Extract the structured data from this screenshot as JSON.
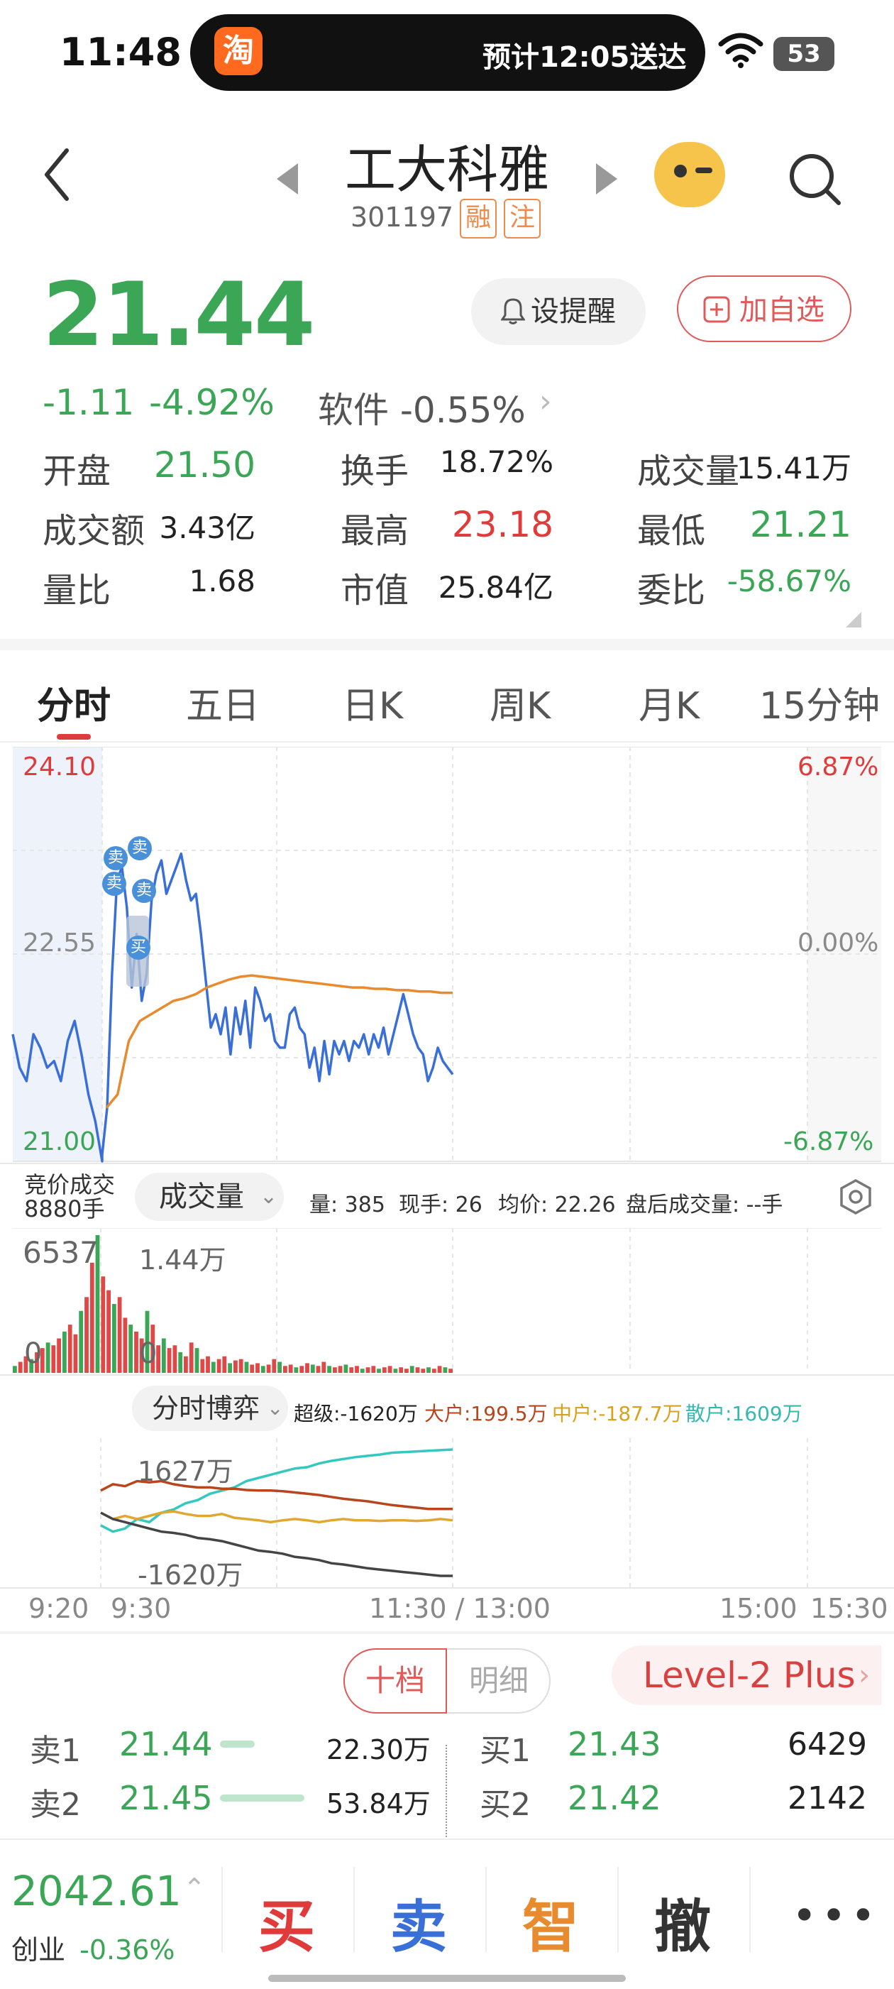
{
  "status": {
    "time": "11:48",
    "island_app_icon": "淘",
    "island_text": "预计12:05送达",
    "battery": "53"
  },
  "header": {
    "title": "工大科雅",
    "code": "301197",
    "tags": [
      "融",
      "注"
    ]
  },
  "quote": {
    "price": "21.44",
    "change": "-1.11",
    "change_pct": "-4.92%",
    "sector": "软件 -0.55%",
    "remind_label": "设提醒",
    "add_fav_label": "加自选",
    "stats": [
      {
        "label": "开盘",
        "value": "21.50",
        "color": "green"
      },
      {
        "label": "换手",
        "value": "18.72%",
        "color": "black"
      },
      {
        "label": "成交量",
        "value": "15.41万",
        "color": "black"
      },
      {
        "label": "成交额",
        "value": "3.43亿",
        "color": "black"
      },
      {
        "label": "最高",
        "value": "23.18",
        "color": "red"
      },
      {
        "label": "最低",
        "value": "21.21",
        "color": "green"
      },
      {
        "label": "量比",
        "value": "1.68",
        "color": "black"
      },
      {
        "label": "市值",
        "value": "25.84亿",
        "color": "black"
      },
      {
        "label": "委比",
        "value": "-58.67%",
        "color": "green"
      }
    ]
  },
  "tabs": [
    "分时",
    "五日",
    "日K",
    "周K",
    "月K",
    "15分钟"
  ],
  "intraday": {
    "y_top": "24.10",
    "y_mid": "22.55",
    "y_bot": "21.00",
    "pct_top": "6.87%",
    "pct_mid": "0.00%",
    "pct_bot": "-6.87%",
    "sell_marker": "卖",
    "buy_marker": "买",
    "price_line": [
      21.95,
      21.7,
      21.6,
      21.95,
      21.85,
      21.7,
      21.75,
      21.6,
      21.9,
      22.05,
      21.8,
      21.5,
      21.3,
      21.0,
      21.05,
      21.4,
      22.4,
      23.1,
      23.2,
      22.9,
      22.3,
      22.7,
      22.2,
      22.4,
      22.95,
      23.15,
      23.25,
      23.0,
      23.1,
      23.2,
      23.3,
      23.1,
      22.95,
      23.0,
      22.7,
      22.35,
      22.0,
      22.1,
      21.95,
      22.15,
      21.8,
      22.15,
      21.95,
      22.2,
      21.85,
      22.3,
      22.2,
      22.05,
      22.1,
      21.9,
      21.85,
      21.85,
      22.1,
      22.15,
      22.0,
      21.95,
      21.7,
      21.85,
      21.6,
      21.9,
      21.65,
      21.9,
      21.8,
      21.9,
      21.75,
      21.9,
      21.85,
      21.95,
      21.8,
      21.95,
      21.85,
      22.0,
      21.8,
      21.95,
      22.1,
      22.25,
      22.1,
      21.95,
      21.85,
      21.8,
      21.6,
      21.7,
      21.85,
      21.75,
      21.7,
      21.65
    ],
    "avg_line": [
      21.4,
      21.5,
      21.9,
      22.05,
      22.1,
      22.15,
      22.2,
      22.22,
      22.25,
      22.3,
      22.33,
      22.36,
      22.38,
      22.39,
      22.38,
      22.37,
      22.36,
      22.35,
      22.34,
      22.33,
      22.32,
      22.31,
      22.3,
      22.3,
      22.29,
      22.29,
      22.28,
      22.28,
      22.27,
      22.27,
      22.26,
      22.26
    ]
  },
  "volume": {
    "auction_label": "竞价成交",
    "auction_value": "8880手",
    "selector": "成交量",
    "vol": "量: 385",
    "cur": "现手: 26",
    "avg": "均价: 22.26",
    "after": "盘后成交量: --手",
    "y_left_top": "6537",
    "y_left_bot": "0",
    "y_right_top": "1.44万",
    "y_right_bot": "0",
    "bars": [
      0.05,
      0.08,
      0.12,
      0.1,
      0.15,
      0.18,
      0.22,
      0.2,
      0.25,
      0.3,
      0.35,
      0.28,
      0.45,
      0.55,
      0.8,
      1.0,
      0.7,
      0.6,
      0.5,
      0.55,
      0.4,
      0.35,
      0.3,
      0.25,
      0.45,
      0.35,
      0.2,
      0.25,
      0.18,
      0.2,
      0.15,
      0.12,
      0.22,
      0.18,
      0.1,
      0.12,
      0.08,
      0.1,
      0.12,
      0.07,
      0.09,
      0.1,
      0.08,
      0.06,
      0.07,
      0.05,
      0.06,
      0.1,
      0.08,
      0.05,
      0.06,
      0.04,
      0.05,
      0.07,
      0.06,
      0.05,
      0.08,
      0.05,
      0.04,
      0.05,
      0.06,
      0.04,
      0.05,
      0.03,
      0.04,
      0.05,
      0.03,
      0.04,
      0.05,
      0.03,
      0.04,
      0.03,
      0.05,
      0.04,
      0.03,
      0.04,
      0.03,
      0.05,
      0.04,
      0.03
    ]
  },
  "flow": {
    "selector": "分时博弈",
    "super": "超级:-1620万",
    "big": "大户:199.5万",
    "mid": "中户:-187.7万",
    "retail": "散户:1609万",
    "y_top": "1627万",
    "y_bot": "-1620万",
    "series": {
      "retail": [
        -0.2,
        -0.3,
        -0.25,
        -0.1,
        -0.15,
        0.0,
        0.05,
        0.15,
        0.2,
        0.3,
        0.35,
        0.4,
        0.5,
        0.55,
        0.6,
        0.65,
        0.7,
        0.72,
        0.78,
        0.82,
        0.85,
        0.88,
        0.9,
        0.92,
        0.95,
        0.96,
        0.97,
        0.98,
        0.99,
        1.0
      ],
      "big": [
        0.35,
        0.45,
        0.42,
        0.5,
        0.48,
        0.5,
        0.45,
        0.42,
        0.4,
        0.4,
        0.38,
        0.38,
        0.36,
        0.35,
        0.35,
        0.34,
        0.32,
        0.3,
        0.28,
        0.25,
        0.22,
        0.2,
        0.18,
        0.15,
        0.12,
        0.1,
        0.08,
        0.06,
        0.06,
        0.06
      ],
      "mid": [
        0.0,
        -0.1,
        -0.05,
        -0.1,
        -0.05,
        0.0,
        0.02,
        -0.02,
        -0.05,
        -0.05,
        -0.02,
        -0.08,
        -0.1,
        -0.12,
        -0.15,
        -0.12,
        -0.1,
        -0.12,
        -0.15,
        -0.12,
        -0.1,
        -0.12,
        -0.12,
        -0.13,
        -0.12,
        -0.12,
        -0.13,
        -0.12,
        -0.1,
        -0.12
      ],
      "super": [
        0.0,
        -0.1,
        -0.15,
        -0.2,
        -0.25,
        -0.3,
        -0.32,
        -0.35,
        -0.4,
        -0.42,
        -0.45,
        -0.5,
        -0.55,
        -0.6,
        -0.62,
        -0.65,
        -0.7,
        -0.72,
        -0.75,
        -0.8,
        -0.82,
        -0.85,
        -0.88,
        -0.9,
        -0.92,
        -0.94,
        -0.96,
        -0.98,
        -1.0,
        -1.0
      ]
    },
    "x_labels": [
      "9:20",
      "9:30",
      "11:30 / 13:00",
      "15:00",
      "15:30"
    ]
  },
  "orderbook": {
    "seg_a": "十档",
    "seg_b": "明细",
    "level2": "Level-2 Plus",
    "sell": [
      {
        "label": "卖1",
        "price": "21.44",
        "vol": "22.30万",
        "bar": 0.35
      },
      {
        "label": "卖2",
        "price": "21.45",
        "vol": "53.84万",
        "bar": 0.85
      }
    ],
    "buy": [
      {
        "label": "买1",
        "price": "21.43",
        "vol": "6429"
      },
      {
        "label": "买2",
        "price": "21.42",
        "vol": "2142"
      }
    ]
  },
  "bottom": {
    "index_value": "2042.61",
    "index_name": "创业",
    "index_change": "-0.36%",
    "actions": [
      "买",
      "卖",
      "智",
      "撤"
    ],
    "colors": {
      "buy": "#e03b3b",
      "sell": "#3a6fd8",
      "smart": "#e88a2e",
      "cancel": "#333333"
    }
  }
}
